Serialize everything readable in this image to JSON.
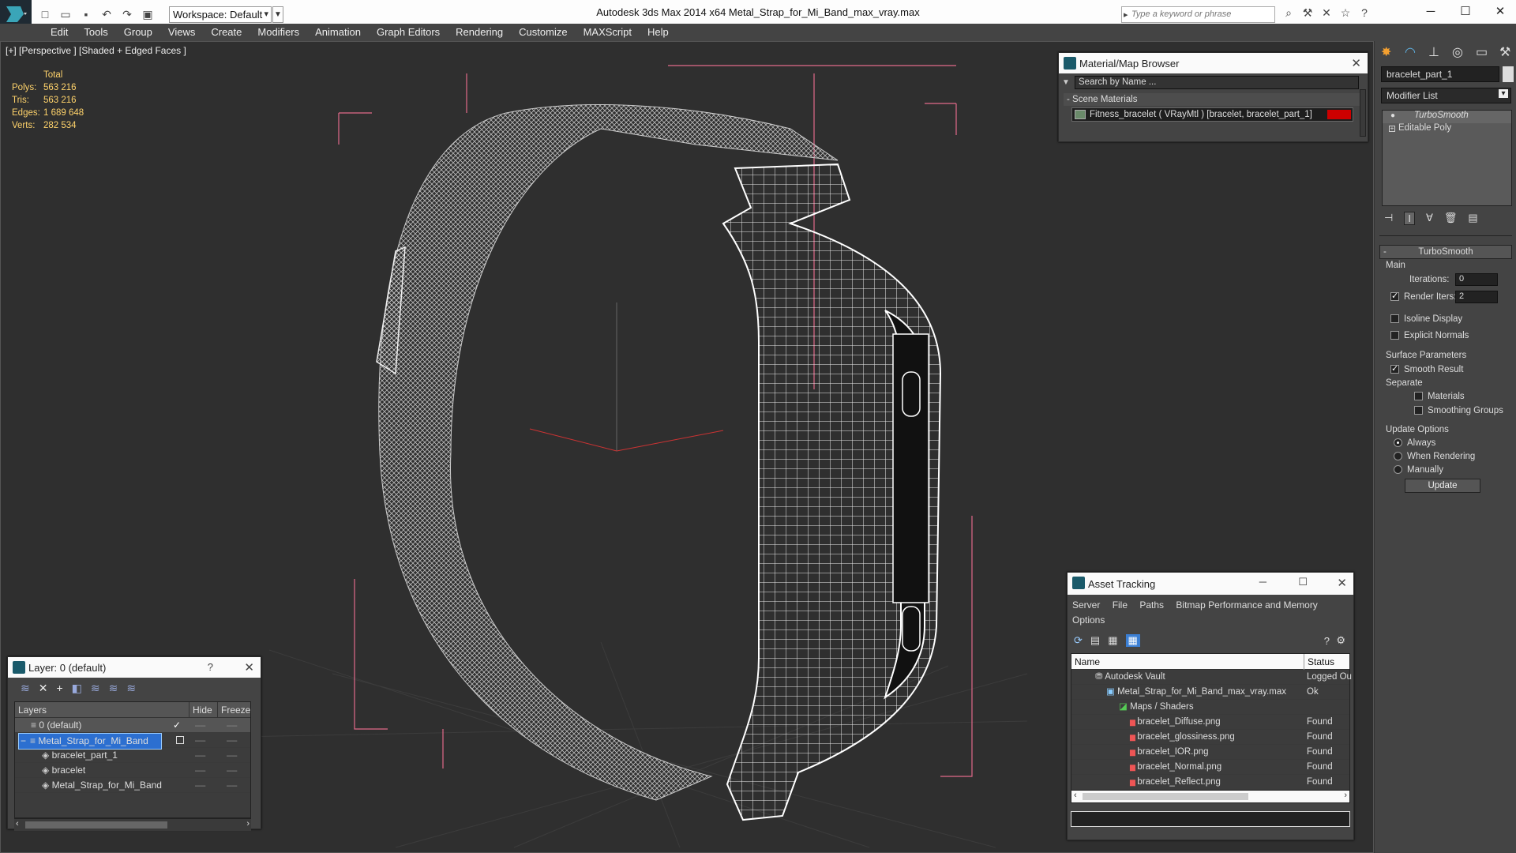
{
  "app": {
    "title": "Autodesk 3ds Max  2014 x64      Metal_Strap_for_Mi_Band_max_vray.max",
    "workspace": "Workspace: Default",
    "search_placeholder": "Type a keyword or phrase",
    "menu": [
      "Edit",
      "Tools",
      "Group",
      "Views",
      "Create",
      "Modifiers",
      "Animation",
      "Graph Editors",
      "Rendering",
      "Customize",
      "MAXScript",
      "Help"
    ]
  },
  "viewport": {
    "label": "[+] [Perspective ] [Shaded + Edged Faces ]",
    "stats": {
      "header": "Total",
      "rows": [
        {
          "k": "Polys:",
          "v": "563 216"
        },
        {
          "k": "Tris:",
          "v": "563 216"
        },
        {
          "k": "Edges:",
          "v": "1 689 648"
        },
        {
          "k": "Verts:",
          "v": "282 534"
        }
      ]
    }
  },
  "material_browser": {
    "title": "Material/Map Browser",
    "search_placeholder": "Search by Name ...",
    "section": "- Scene Materials",
    "item": "Fitness_bracelet  ( VRayMtl ) [bracelet, bracelet_part_1]"
  },
  "command_panel": {
    "object_name": "bracelet_part_1",
    "modifier_list": "Modifier List",
    "stack": [
      "TurboSmooth",
      "Editable Poly"
    ],
    "rollout_title": "TurboSmooth",
    "main_label": "Main",
    "iterations_label": "Iterations:",
    "iterations_value": "0",
    "render_iters_label": "Render Iters:",
    "render_iters_value": "2",
    "isoline": "Isoline Display",
    "explicit_normals": "Explicit Normals",
    "surface_params": "Surface Parameters",
    "smooth_result": "Smooth Result",
    "separate": "Separate",
    "materials": "Materials",
    "smoothing_groups": "Smoothing Groups",
    "update_options": "Update Options",
    "always": "Always",
    "when_rendering": "When Rendering",
    "manually": "Manually",
    "update_btn": "Update"
  },
  "layers": {
    "title": "Layer: 0 (default)",
    "help": "?",
    "col_layers": "Layers",
    "col_hide": "Hide",
    "col_freeze": "Freeze",
    "rows": [
      "0 (default)",
      "Metal_Strap_for_Mi_Band",
      "bracelet_part_1",
      "bracelet",
      "Metal_Strap_for_Mi_Band"
    ]
  },
  "asset_tracking": {
    "title": "Asset Tracking",
    "menu": [
      "Server",
      "File",
      "Paths",
      "Bitmap Performance and Memory",
      "Options"
    ],
    "col_name": "Name",
    "col_status": "Status",
    "rows": [
      {
        "name": "Autodesk Vault",
        "status": "Logged Ou"
      },
      {
        "name": "Metal_Strap_for_Mi_Band_max_vray.max",
        "status": "Ok"
      },
      {
        "name": "Maps / Shaders",
        "status": ""
      },
      {
        "name": "bracelet_Diffuse.png",
        "status": "Found"
      },
      {
        "name": "bracelet_glossiness.png",
        "status": "Found"
      },
      {
        "name": "bracelet_IOR.png",
        "status": "Found"
      },
      {
        "name": "bracelet_Normal.png",
        "status": "Found"
      },
      {
        "name": "bracelet_Reflect.png",
        "status": "Found"
      }
    ]
  }
}
